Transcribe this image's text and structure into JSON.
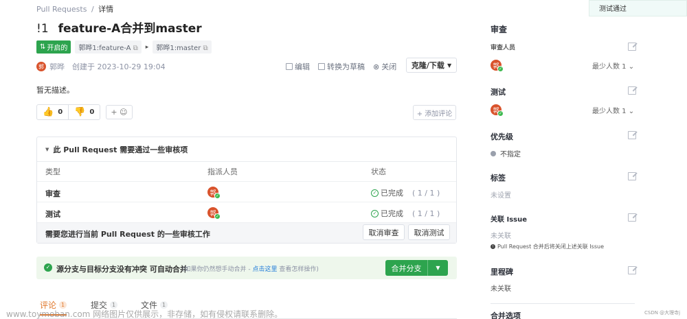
{
  "breadcrumb": {
    "root": "Pull Requests",
    "sep": "/",
    "current": "详情"
  },
  "title": {
    "number": "!1",
    "text": "feature-A合并到master"
  },
  "status_badge": "开启的",
  "branches": {
    "source": "郭晔1:feature-A",
    "target": "郭晔1:master",
    "arrow": "▸"
  },
  "author": {
    "avatar_char": "郭",
    "name": "郭晔",
    "created": "创建于 2023-10-29 19:04"
  },
  "actions": {
    "edit": "编辑",
    "draft": "转换为草稿",
    "close": "关闭",
    "clone": "克隆/下载"
  },
  "description": "暂无描述。",
  "reactions": {
    "thumbs_up": "0",
    "thumbs_down": "0",
    "add": "+ ☺"
  },
  "add_comment": "+ 添加评论",
  "review": {
    "header": "此 Pull Request 需要通过一些审核项",
    "columns": [
      "类型",
      "指派人员",
      "状态"
    ],
    "rows": [
      {
        "type": "审查",
        "status": "已完成",
        "progress": "( 1 / 1 )"
      },
      {
        "type": "测试",
        "status": "已完成",
        "progress": "( 1 / 1 )"
      }
    ],
    "footer": "需要您进行当前 Pull Request 的一些审核工作",
    "cancel_review": "取消审查",
    "cancel_test": "取消测试"
  },
  "merge": {
    "text": "源分支与目标分支没有冲突 可自动合并",
    "hint_prefix": "(如果你仍然想手动合并 - ",
    "hint_link": "点击这里",
    "hint_suffix": " 查看怎样操作)",
    "button": "合并分支"
  },
  "tabs": [
    {
      "label": "评论",
      "count": "1"
    },
    {
      "label": "提交",
      "count": "1"
    },
    {
      "label": "文件",
      "count": "1"
    }
  ],
  "watermark": "www.toymoban.com 网络图片仅供展示，非存储，如有侵权请联系删除。",
  "csdn": "CSDN @大理寺j",
  "sidebar": {
    "toast": "测试通过",
    "review_title": "审查",
    "reviewers_label": "审查人员",
    "min_people": "最少人数 1",
    "test_title": "测试",
    "priority_title": "优先级",
    "priority_value": "不指定",
    "labels_title": "标签",
    "labels_value": "未设置",
    "issue_title": "关联 Issue",
    "issue_value": "未关联",
    "issue_note": "Pull Request 合并后将关闭上述关联 Issue",
    "milestone_title": "里程碑",
    "milestone_value": "未关联",
    "merge_options_title": "合并选项"
  },
  "colors": {
    "green": "#2da44e",
    "merge_bg": "#eef7ec",
    "accent": "#e0782c"
  }
}
